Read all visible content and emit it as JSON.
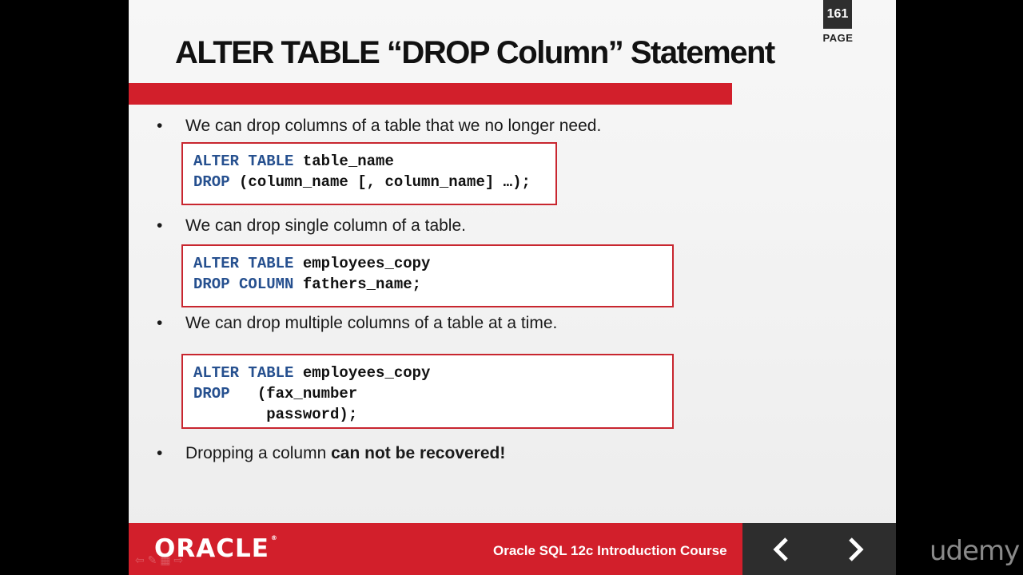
{
  "page": {
    "number": "161",
    "label": "PAGE"
  },
  "title": "ALTER TABLE “DROP Column” Statement",
  "bullets": [
    "We can drop columns of a table that we no longer need.",
    "We can drop single column of a table.",
    "We can drop multiple columns of a table at a time.",
    {
      "prefix": "Dropping a column ",
      "bold": "can not be recovered!"
    }
  ],
  "code_blocks": [
    {
      "lines": [
        {
          "kw": "ALTER TABLE",
          "rest": " table_name"
        },
        {
          "kw": "DROP",
          "rest": " (column_name [, column_name] …);"
        }
      ]
    },
    {
      "lines": [
        {
          "kw": "ALTER TABLE",
          "rest": " employees_copy"
        },
        {
          "kw": "DROP COLUMN",
          "rest": " fathers_name;"
        }
      ]
    },
    {
      "lines": [
        {
          "kw": "ALTER TABLE",
          "rest": " employees_copy"
        },
        {
          "kw": "DROP",
          "rest": "   (fax_number"
        },
        {
          "kw": "",
          "rest": "        password);"
        }
      ]
    }
  ],
  "footer": {
    "logo": "ORACLE",
    "course": "Oracle SQL 12c Introduction Course",
    "prev_icon": "chevron-left-icon",
    "next_icon": "chevron-right-icon"
  },
  "watermark": "udemy",
  "colors": {
    "accent": "#d21f2b",
    "keyword": "#26508f",
    "nav_bg": "#2d2d2d"
  }
}
